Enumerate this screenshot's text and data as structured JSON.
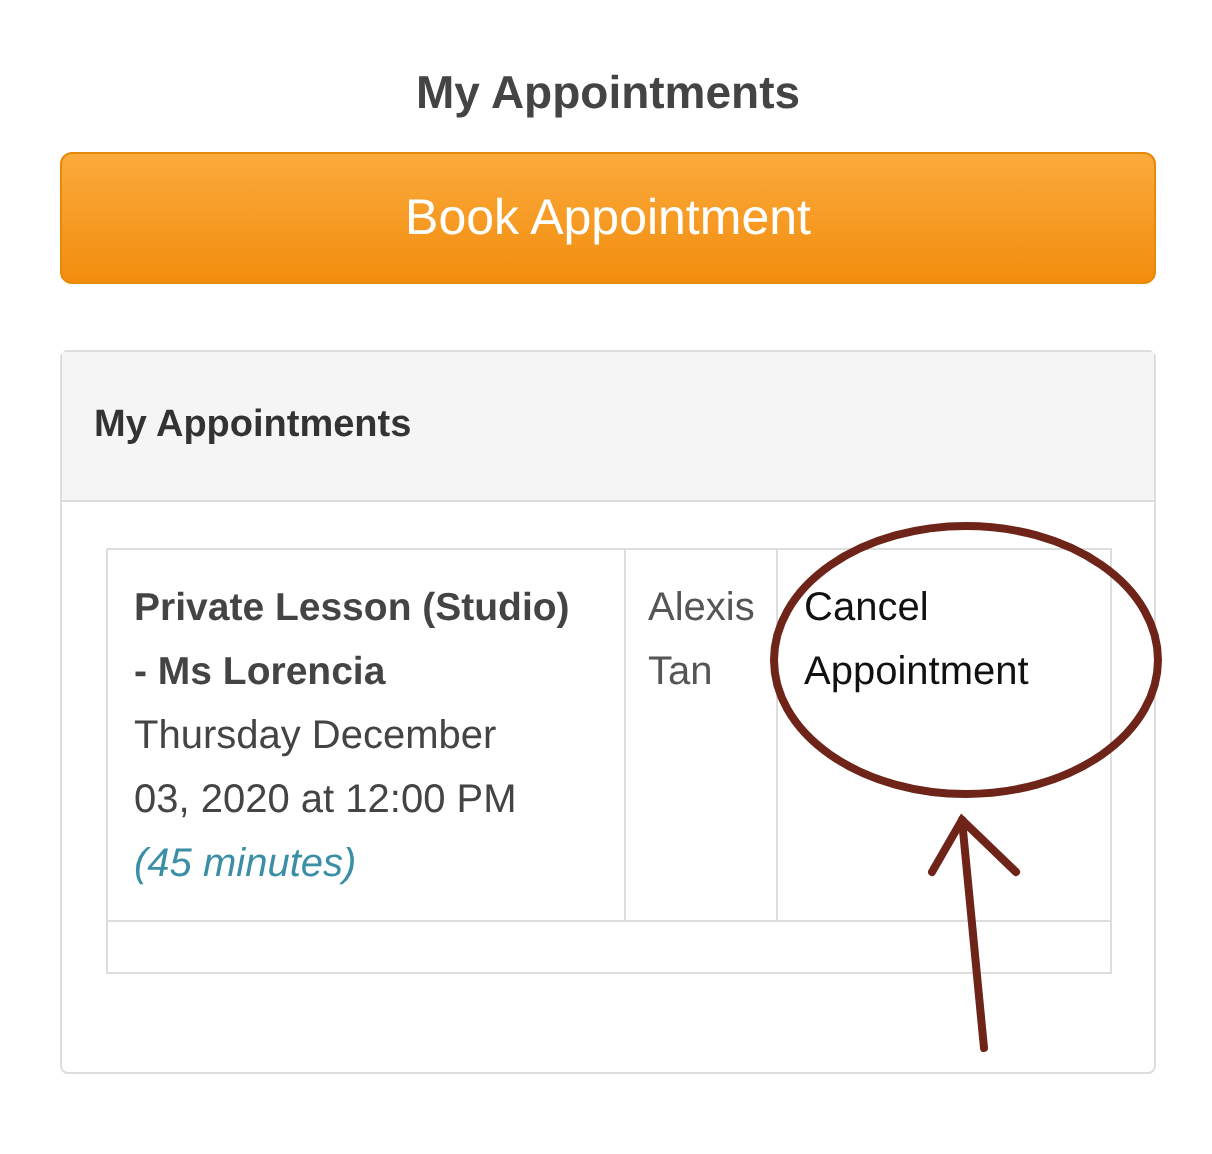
{
  "page_title": "My Appointments",
  "book_button": {
    "label": "Book Appointment"
  },
  "panel": {
    "title": "My Appointments",
    "appointments": [
      {
        "title": "Private Lesson (Studio) - Ms Lorencia",
        "datetime": "Thursday December 03, 2020 at 12:00 PM",
        "duration": "(45 minutes)",
        "client": "Alexis Tan",
        "action": "Cancel Appointment"
      }
    ]
  },
  "annotation": {
    "kind": "circle-arrow"
  }
}
